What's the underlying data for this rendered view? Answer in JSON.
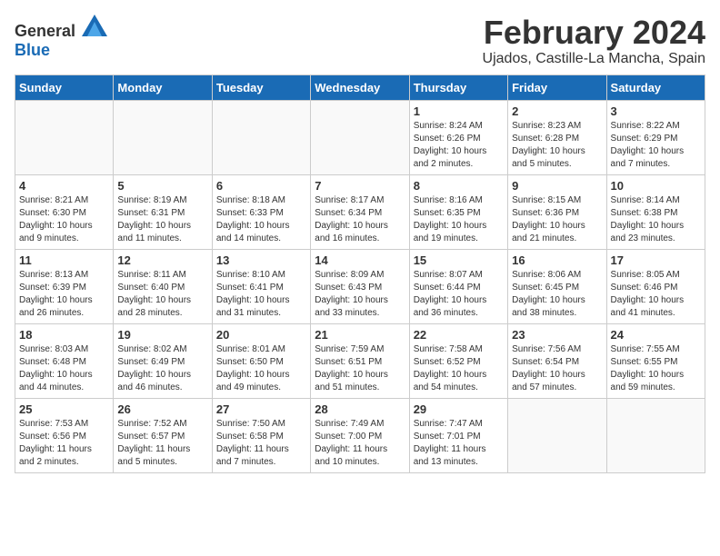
{
  "header": {
    "logo_general": "General",
    "logo_blue": "Blue",
    "month_title": "February 2024",
    "location": "Ujados, Castille-La Mancha, Spain"
  },
  "weekdays": [
    "Sunday",
    "Monday",
    "Tuesday",
    "Wednesday",
    "Thursday",
    "Friday",
    "Saturday"
  ],
  "weeks": [
    [
      {
        "day": "",
        "info": ""
      },
      {
        "day": "",
        "info": ""
      },
      {
        "day": "",
        "info": ""
      },
      {
        "day": "",
        "info": ""
      },
      {
        "day": "1",
        "info": "Sunrise: 8:24 AM\nSunset: 6:26 PM\nDaylight: 10 hours\nand 2 minutes."
      },
      {
        "day": "2",
        "info": "Sunrise: 8:23 AM\nSunset: 6:28 PM\nDaylight: 10 hours\nand 5 minutes."
      },
      {
        "day": "3",
        "info": "Sunrise: 8:22 AM\nSunset: 6:29 PM\nDaylight: 10 hours\nand 7 minutes."
      }
    ],
    [
      {
        "day": "4",
        "info": "Sunrise: 8:21 AM\nSunset: 6:30 PM\nDaylight: 10 hours\nand 9 minutes."
      },
      {
        "day": "5",
        "info": "Sunrise: 8:19 AM\nSunset: 6:31 PM\nDaylight: 10 hours\nand 11 minutes."
      },
      {
        "day": "6",
        "info": "Sunrise: 8:18 AM\nSunset: 6:33 PM\nDaylight: 10 hours\nand 14 minutes."
      },
      {
        "day": "7",
        "info": "Sunrise: 8:17 AM\nSunset: 6:34 PM\nDaylight: 10 hours\nand 16 minutes."
      },
      {
        "day": "8",
        "info": "Sunrise: 8:16 AM\nSunset: 6:35 PM\nDaylight: 10 hours\nand 19 minutes."
      },
      {
        "day": "9",
        "info": "Sunrise: 8:15 AM\nSunset: 6:36 PM\nDaylight: 10 hours\nand 21 minutes."
      },
      {
        "day": "10",
        "info": "Sunrise: 8:14 AM\nSunset: 6:38 PM\nDaylight: 10 hours\nand 23 minutes."
      }
    ],
    [
      {
        "day": "11",
        "info": "Sunrise: 8:13 AM\nSunset: 6:39 PM\nDaylight: 10 hours\nand 26 minutes."
      },
      {
        "day": "12",
        "info": "Sunrise: 8:11 AM\nSunset: 6:40 PM\nDaylight: 10 hours\nand 28 minutes."
      },
      {
        "day": "13",
        "info": "Sunrise: 8:10 AM\nSunset: 6:41 PM\nDaylight: 10 hours\nand 31 minutes."
      },
      {
        "day": "14",
        "info": "Sunrise: 8:09 AM\nSunset: 6:43 PM\nDaylight: 10 hours\nand 33 minutes."
      },
      {
        "day": "15",
        "info": "Sunrise: 8:07 AM\nSunset: 6:44 PM\nDaylight: 10 hours\nand 36 minutes."
      },
      {
        "day": "16",
        "info": "Sunrise: 8:06 AM\nSunset: 6:45 PM\nDaylight: 10 hours\nand 38 minutes."
      },
      {
        "day": "17",
        "info": "Sunrise: 8:05 AM\nSunset: 6:46 PM\nDaylight: 10 hours\nand 41 minutes."
      }
    ],
    [
      {
        "day": "18",
        "info": "Sunrise: 8:03 AM\nSunset: 6:48 PM\nDaylight: 10 hours\nand 44 minutes."
      },
      {
        "day": "19",
        "info": "Sunrise: 8:02 AM\nSunset: 6:49 PM\nDaylight: 10 hours\nand 46 minutes."
      },
      {
        "day": "20",
        "info": "Sunrise: 8:01 AM\nSunset: 6:50 PM\nDaylight: 10 hours\nand 49 minutes."
      },
      {
        "day": "21",
        "info": "Sunrise: 7:59 AM\nSunset: 6:51 PM\nDaylight: 10 hours\nand 51 minutes."
      },
      {
        "day": "22",
        "info": "Sunrise: 7:58 AM\nSunset: 6:52 PM\nDaylight: 10 hours\nand 54 minutes."
      },
      {
        "day": "23",
        "info": "Sunrise: 7:56 AM\nSunset: 6:54 PM\nDaylight: 10 hours\nand 57 minutes."
      },
      {
        "day": "24",
        "info": "Sunrise: 7:55 AM\nSunset: 6:55 PM\nDaylight: 10 hours\nand 59 minutes."
      }
    ],
    [
      {
        "day": "25",
        "info": "Sunrise: 7:53 AM\nSunset: 6:56 PM\nDaylight: 11 hours\nand 2 minutes."
      },
      {
        "day": "26",
        "info": "Sunrise: 7:52 AM\nSunset: 6:57 PM\nDaylight: 11 hours\nand 5 minutes."
      },
      {
        "day": "27",
        "info": "Sunrise: 7:50 AM\nSunset: 6:58 PM\nDaylight: 11 hours\nand 7 minutes."
      },
      {
        "day": "28",
        "info": "Sunrise: 7:49 AM\nSunset: 7:00 PM\nDaylight: 11 hours\nand 10 minutes."
      },
      {
        "day": "29",
        "info": "Sunrise: 7:47 AM\nSunset: 7:01 PM\nDaylight: 11 hours\nand 13 minutes."
      },
      {
        "day": "",
        "info": ""
      },
      {
        "day": "",
        "info": ""
      }
    ]
  ]
}
